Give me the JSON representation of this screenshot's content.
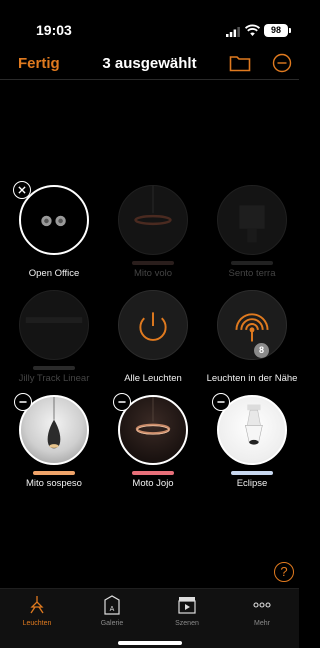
{
  "status": {
    "time": "19:03",
    "battery": "98"
  },
  "header": {
    "done_label": "Fertig",
    "title": "3 ausgewählt"
  },
  "colors": {
    "accent": "#e07a1f"
  },
  "lights": [
    {
      "label": "Open Office",
      "state": "selected-remove"
    },
    {
      "label": "Mito volo",
      "state": "unavailable"
    },
    {
      "label": "Sento terra",
      "state": "unavailable"
    },
    {
      "label": "Jilly Track Linear",
      "state": "unavailable"
    },
    {
      "label": "Alle Leuchten",
      "state": "available"
    },
    {
      "label": "Leuchten in der Nähe",
      "state": "available",
      "count": "8"
    },
    {
      "label": "Mito sospeso",
      "state": "selected",
      "bar_color": "#f0a46a"
    },
    {
      "label": "Moto Jojo",
      "state": "selected",
      "bar_color": "#e8707a"
    },
    {
      "label": "Eclipse",
      "state": "selected",
      "bar_color": "#c8d8f0"
    }
  ],
  "help_label": "?",
  "tabs": [
    {
      "label": "Leuchten",
      "icon": "lamp-icon",
      "active": true
    },
    {
      "label": "Galerie",
      "icon": "gallery-icon",
      "active": false
    },
    {
      "label": "Szenen",
      "icon": "scenes-icon",
      "active": false
    },
    {
      "label": "Mehr",
      "icon": "more-icon",
      "active": false
    }
  ]
}
